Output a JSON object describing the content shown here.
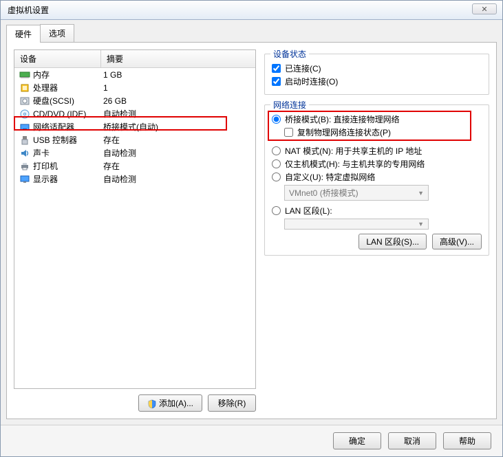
{
  "window": {
    "title": "虚拟机设置",
    "close_glyph": "✕"
  },
  "tabs": [
    {
      "label": "硬件",
      "active": true
    },
    {
      "label": "选项",
      "active": false
    }
  ],
  "device_table": {
    "col_device": "设备",
    "col_summary": "摘要",
    "rows": [
      {
        "icon": "memory-icon",
        "name": "内存",
        "summary": "1 GB"
      },
      {
        "icon": "cpu-icon",
        "name": "处理器",
        "summary": "1"
      },
      {
        "icon": "disk-icon",
        "name": "硬盘(SCSI)",
        "summary": "26 GB"
      },
      {
        "icon": "cd-icon",
        "name": "CD/DVD (IDE)",
        "summary": "自动检测"
      },
      {
        "icon": "nic-icon",
        "name": "网络适配器",
        "summary": "桥接模式(自动)",
        "highlight": true
      },
      {
        "icon": "usb-icon",
        "name": "USB 控制器",
        "summary": "存在"
      },
      {
        "icon": "sound-icon",
        "name": "声卡",
        "summary": "自动检测"
      },
      {
        "icon": "printer-icon",
        "name": "打印机",
        "summary": "存在"
      },
      {
        "icon": "display-icon",
        "name": "显示器",
        "summary": "自动检测"
      }
    ]
  },
  "left_buttons": {
    "add": "添加(A)...",
    "remove": "移除(R)"
  },
  "device_state": {
    "title": "设备状态",
    "connected": {
      "label": "已连接(C)",
      "checked": true
    },
    "connect_at_power": {
      "label": "启动时连接(O)",
      "checked": true
    }
  },
  "net_conn": {
    "title": "网络连接",
    "bridged": {
      "label": "桥接模式(B): 直接连接物理网络",
      "selected": true
    },
    "replicate": {
      "label": "复制物理网络连接状态(P)",
      "checked": false
    },
    "nat": {
      "label": "NAT 模式(N): 用于共享主机的 IP 地址",
      "selected": false
    },
    "hostonly": {
      "label": "仅主机模式(H): 与主机共享的专用网络",
      "selected": false
    },
    "custom": {
      "label": "自定义(U): 特定虚拟网络",
      "selected": false
    },
    "custom_value": "VMnet0 (桥接模式)",
    "lanseg": {
      "label": "LAN 区段(L):",
      "selected": false
    },
    "lanseg_value": "",
    "btn_lanseg": "LAN 区段(S)...",
    "btn_adv": "高级(V)..."
  },
  "footer": {
    "ok": "确定",
    "cancel": "取消",
    "help": "帮助"
  }
}
